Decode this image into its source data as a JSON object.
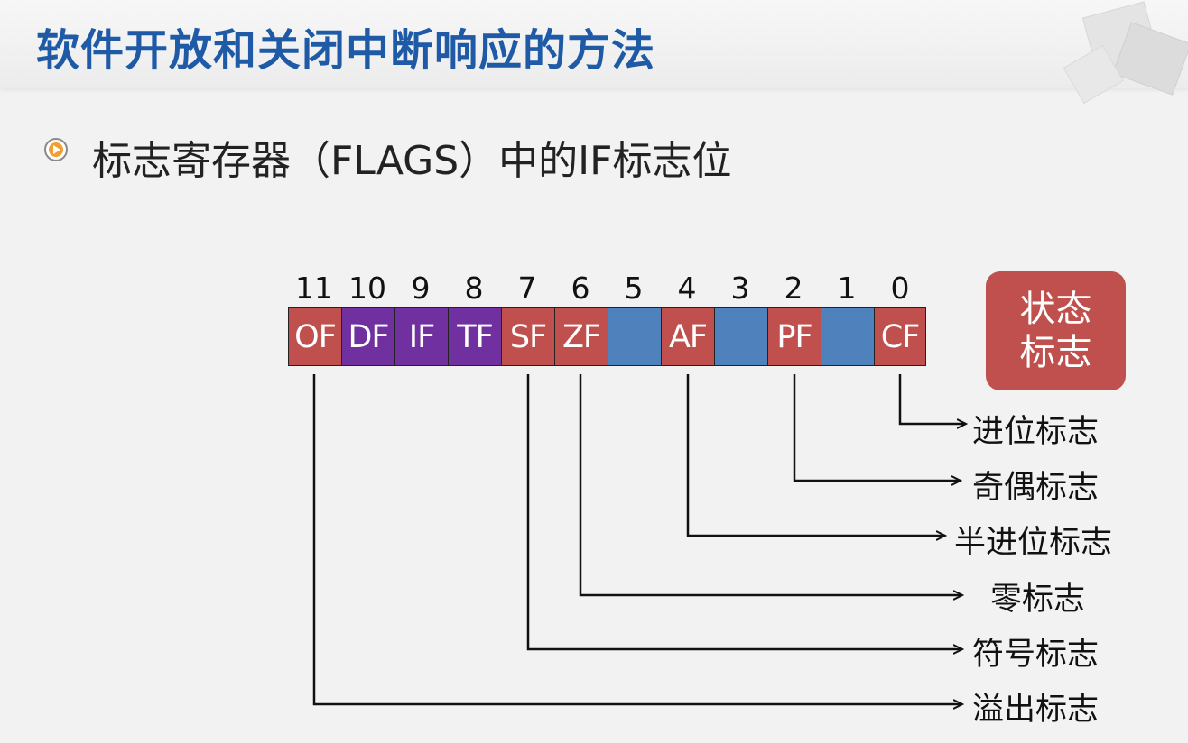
{
  "slide": {
    "title": "软件开放和关闭中断响应的方法",
    "bullet": "标志寄存器（FLAGS）中的IF标志位"
  },
  "register": {
    "bits": [
      {
        "num": "11",
        "flag": "OF",
        "color": "#c0504d"
      },
      {
        "num": "10",
        "flag": "DF",
        "color": "#7030a0"
      },
      {
        "num": "9",
        "flag": "IF",
        "color": "#7030a0"
      },
      {
        "num": "8",
        "flag": "TF",
        "color": "#7030a0"
      },
      {
        "num": "7",
        "flag": "SF",
        "color": "#c0504d"
      },
      {
        "num": "6",
        "flag": "ZF",
        "color": "#c0504d"
      },
      {
        "num": "5",
        "flag": "",
        "color": "#4f81bd"
      },
      {
        "num": "4",
        "flag": "AF",
        "color": "#c0504d"
      },
      {
        "num": "3",
        "flag": "",
        "color": "#4f81bd"
      },
      {
        "num": "2",
        "flag": "PF",
        "color": "#c0504d"
      },
      {
        "num": "1",
        "flag": "",
        "color": "#4f81bd"
      },
      {
        "num": "0",
        "flag": "CF",
        "color": "#c0504d"
      }
    ]
  },
  "state_flags_box": {
    "line1": "状态",
    "line2": "标志"
  },
  "descriptions": [
    {
      "flag": "CF",
      "label": "进位标志"
    },
    {
      "flag": "PF",
      "label": "奇偶标志"
    },
    {
      "flag": "AF",
      "label": "半进位标志"
    },
    {
      "flag": "ZF",
      "label": "零标志"
    },
    {
      "flag": "SF",
      "label": "符号标志"
    },
    {
      "flag": "OF",
      "label": "溢出标志"
    }
  ],
  "colors": {
    "title": "#1e5aa6",
    "status_flag": "#c0504d",
    "control_flag": "#7030a0",
    "unused_bit": "#4f81bd"
  }
}
